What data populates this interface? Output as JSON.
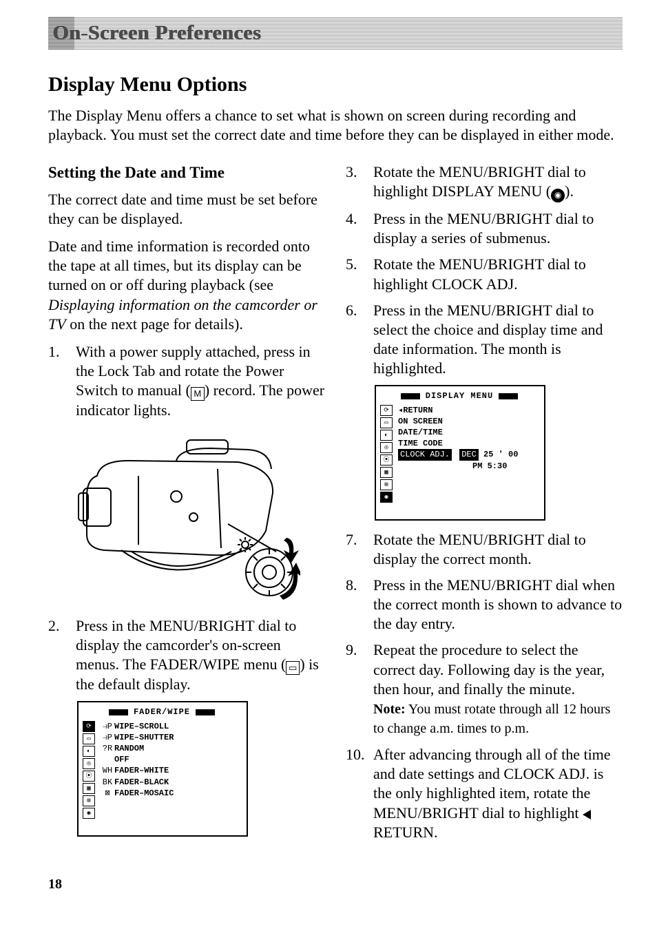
{
  "banner": {
    "title": "On-Screen Preferences"
  },
  "section": {
    "title": "Display Menu Options",
    "intro": "The Display Menu offers a chance to set what is shown on screen during recording and playback. You must set the correct date and time before they can be displayed in either mode."
  },
  "left": {
    "heading": "Setting the Date and Time",
    "p1": "The correct date and time must be set before they can be displayed.",
    "p2a": "Date and time information is recorded onto the tape at all times, but its display can be turned on or off during playback (see ",
    "p2i": "Displaying information on the camcorder or TV",
    "p2b": " on the next page for details).",
    "steps": {
      "s1a": "With a power supply attached, press in the Lock Tab and rotate the Power Switch to manual (",
      "s1_glyph": "M",
      "s1b": ") record. The power indicator lights.",
      "s2a": "Press in the MENU/BRIGHT dial to display the camcorder's on-screen menus. The FADER/WIPE menu (",
      "s2_glyph": "▭",
      "s2b": ") is the default display."
    }
  },
  "right": {
    "steps": {
      "s3a": "Rotate the MENU/BRIGHT dial to highlight DISPLAY MENU (",
      "s3_glyph": "◉",
      "s3b": ").",
      "s4": "Press in the MENU/BRIGHT dial to display a series of submenus.",
      "s5": "Rotate the MENU/BRIGHT dial to highlight CLOCK ADJ.",
      "s6": "Press in the MENU/BRIGHT dial to select the choice and display time and date information. The month is highlighted.",
      "s7": "Rotate the MENU/BRIGHT dial to display the correct month.",
      "s8": "Press in the MENU/BRIGHT dial when the correct month is shown to advance to the day entry.",
      "s9": "Repeat the procedure to select the correct day. Following day is the year, then hour, and finally the minute.",
      "note_label": "Note:",
      "note": " You must rotate through all 12 hours to change a.m. times to p.m.",
      "s10a": "After advancing through all of the time and date settings and CLOCK ADJ. is the only highlighted item, rotate the MENU/BRIGHT dial to highlight ",
      "s10b": "RETURN."
    }
  },
  "menus": {
    "fader": {
      "title": "FADER/WIPE",
      "icons": [
        "⟳",
        "▭",
        "◐",
        "◎",
        "⦿",
        "▦",
        "⊞",
        "◉"
      ],
      "active_icon_index": 0,
      "items": [
        {
          "icon": "⥽P",
          "label": "WIPE–SCROLL"
        },
        {
          "icon": "⥽P",
          "label": "WIPE–SHUTTER"
        },
        {
          "icon": "?R",
          "label": "RANDOM"
        },
        {
          "icon": "",
          "label": "OFF"
        },
        {
          "icon": "WH",
          "label": "FADER–WHITE"
        },
        {
          "icon": "BK",
          "label": "FADER–BLACK"
        },
        {
          "icon": "⊠",
          "label": "FADER–MOSAIC"
        }
      ]
    },
    "display": {
      "title": "DISPLAY  MENU",
      "icons": [
        "⟳",
        "▭",
        "◐",
        "◎",
        "⦿",
        "▦",
        "⊞",
        "◉"
      ],
      "lines": {
        "l1": "◂RETURN",
        "l2": "ON  SCREEN",
        "l3": "DATE/TIME",
        "l4": "TIME  CODE",
        "l5_hl": "CLOCK ADJ.",
        "l5_month_hl": "DEC",
        "l5_rest": "25 ' 00",
        "l6": "PM   5:30"
      }
    }
  },
  "page_number": "18"
}
